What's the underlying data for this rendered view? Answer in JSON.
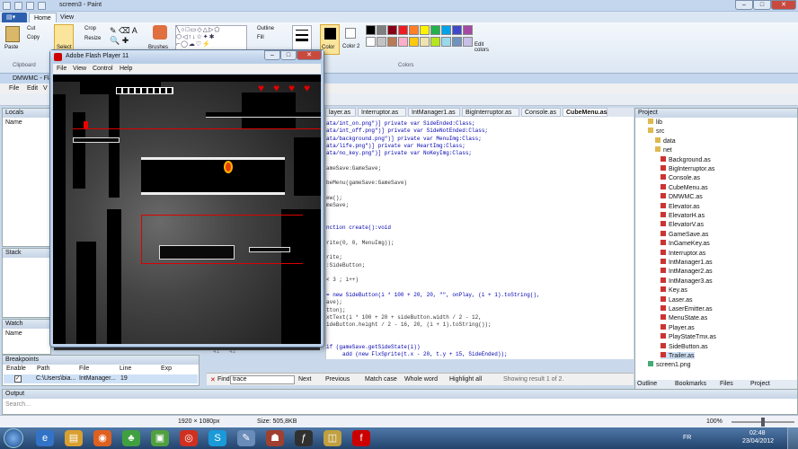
{
  "paint": {
    "title": "screen3 - Paint",
    "tabs": [
      "Home",
      "View"
    ],
    "clipboard": {
      "paste": "Paste",
      "cut": "Cut",
      "copy": "Copy",
      "label": "Clipboard"
    },
    "image": {
      "crop": "Crop",
      "resize": "Resize",
      "select": "Select"
    },
    "tools": {
      "brushes": "Brushes",
      "size": "Size",
      "outline": "Outline",
      "fill": "Fill"
    },
    "colors": {
      "color1": "Color 1",
      "color2": "Color 2",
      "edit": "Edit colors",
      "label": "Colors"
    },
    "palette": [
      "#000000",
      "#7f7f7f",
      "#880015",
      "#ed1c24",
      "#ff7f27",
      "#fff200",
      "#22b14c",
      "#00a2e8",
      "#3f48cc",
      "#a349a4",
      "#ffffff",
      "#c3c3c3",
      "#b97a57",
      "#ffaec9",
      "#ffc90e",
      "#efe4b0",
      "#b5e61d",
      "#99d9ea",
      "#7092be",
      "#c8bfe7"
    ]
  },
  "flash": {
    "title": "Adobe Flash Player 11",
    "menu": [
      "File",
      "View",
      "Control",
      "Help"
    ],
    "hearts": 4
  },
  "ide": {
    "title": "DMWMC - Fla",
    "menu": [
      "File",
      "Edit",
      "V"
    ],
    "locals_title": "Locals",
    "locals_col": "Name",
    "stack_title": "Stack",
    "watch_title": "Watch",
    "watch_col": "Name",
    "breakpoints": {
      "title": "Breakpoints",
      "cols": [
        "Enable",
        "Path",
        "File",
        "Line",
        "Exp"
      ],
      "row": {
        "path": "C:\\Users\\bia...",
        "file": "IntManager...",
        "line": "19"
      }
    },
    "output_title": "Output",
    "search_placeholder": "Search...",
    "editor_tabs": [
      "layer.as",
      "Interruptor.as",
      "IntManager1.as",
      "BigInterruptor.as",
      "Console.as",
      "CubeMenu.as"
    ],
    "code_lines": [
      "ata/int_on.png\")] private var SideEnded:Class;",
      "ata/int_off.png\")] private var SideNotEnded:Class;",
      "ata/background.png\")] private var MenuImg:Class;",
      "ata/life.png\")] private var HeartImg:Class;",
      "ata/no_key.png\")] private var NoKeyImg:Class;",
      "",
      "ameSave:GameSave;",
      "",
      "beMenu(gameSave:GameSave)",
      "",
      "ew();",
      "meSave;",
      "",
      "",
      "nction create():void",
      "",
      "rite(0, 0, MenuImg));",
      "",
      "rite;",
      ":SideButton;",
      "",
      "< 3 ; i++)",
      "",
      "= new SideButton(i * 100 + 20, 20, \"\", onPlay, (i + 1).toString(),",
      "ave);",
      "tton);",
      "xtText(i * 100 + 20 + sideButton.width / 2 - 12,",
      "ideButton.height / 2 - 16, 20, (i + 1).toString());",
      "",
      "",
      "if (gameSave.getSideState(i))",
      "     add (new FlxSprite(t.x - 20, t.y + 15, SideEnded));"
    ],
    "line_numbers": [
      "41",
      "42"
    ],
    "project": {
      "title": "Project",
      "items": [
        "lib",
        "src",
        "data",
        "net",
        "Background.as",
        "BigInterruptor.as",
        "Console.as",
        "CubeMenu.as",
        "DMWMC.as",
        "Elevator.as",
        "ElevatorH.as",
        "ElevatorV.as",
        "GameSave.as",
        "InGameKey.as",
        "Interruptor.as",
        "IntManager1.as",
        "IntManager2.as",
        "IntManager3.as",
        "Key.as",
        "Laser.as",
        "LaserEmitter.as",
        "MenuState.as",
        "Player.as",
        "PlayStateTmx.as",
        "SideButton.as",
        "Trailer.as",
        "screen1.png"
      ],
      "tabs": [
        "Outline",
        "Bookmarks",
        "Files",
        "Project"
      ]
    },
    "find": {
      "label": "Find:",
      "value": "trace",
      "next": "Next",
      "previous": "Previous",
      "match_case": "Match case",
      "whole_word": "Whole word",
      "highlight": "Highlight all",
      "result": "Showing result 1 of 2."
    }
  },
  "status": {
    "dims": "1920 × 1080px",
    "size": "Size: 505,8KB",
    "zoom": "100%"
  },
  "taskbar": {
    "time": "02:48",
    "date": "23/04/2012",
    "lang": "FR"
  }
}
